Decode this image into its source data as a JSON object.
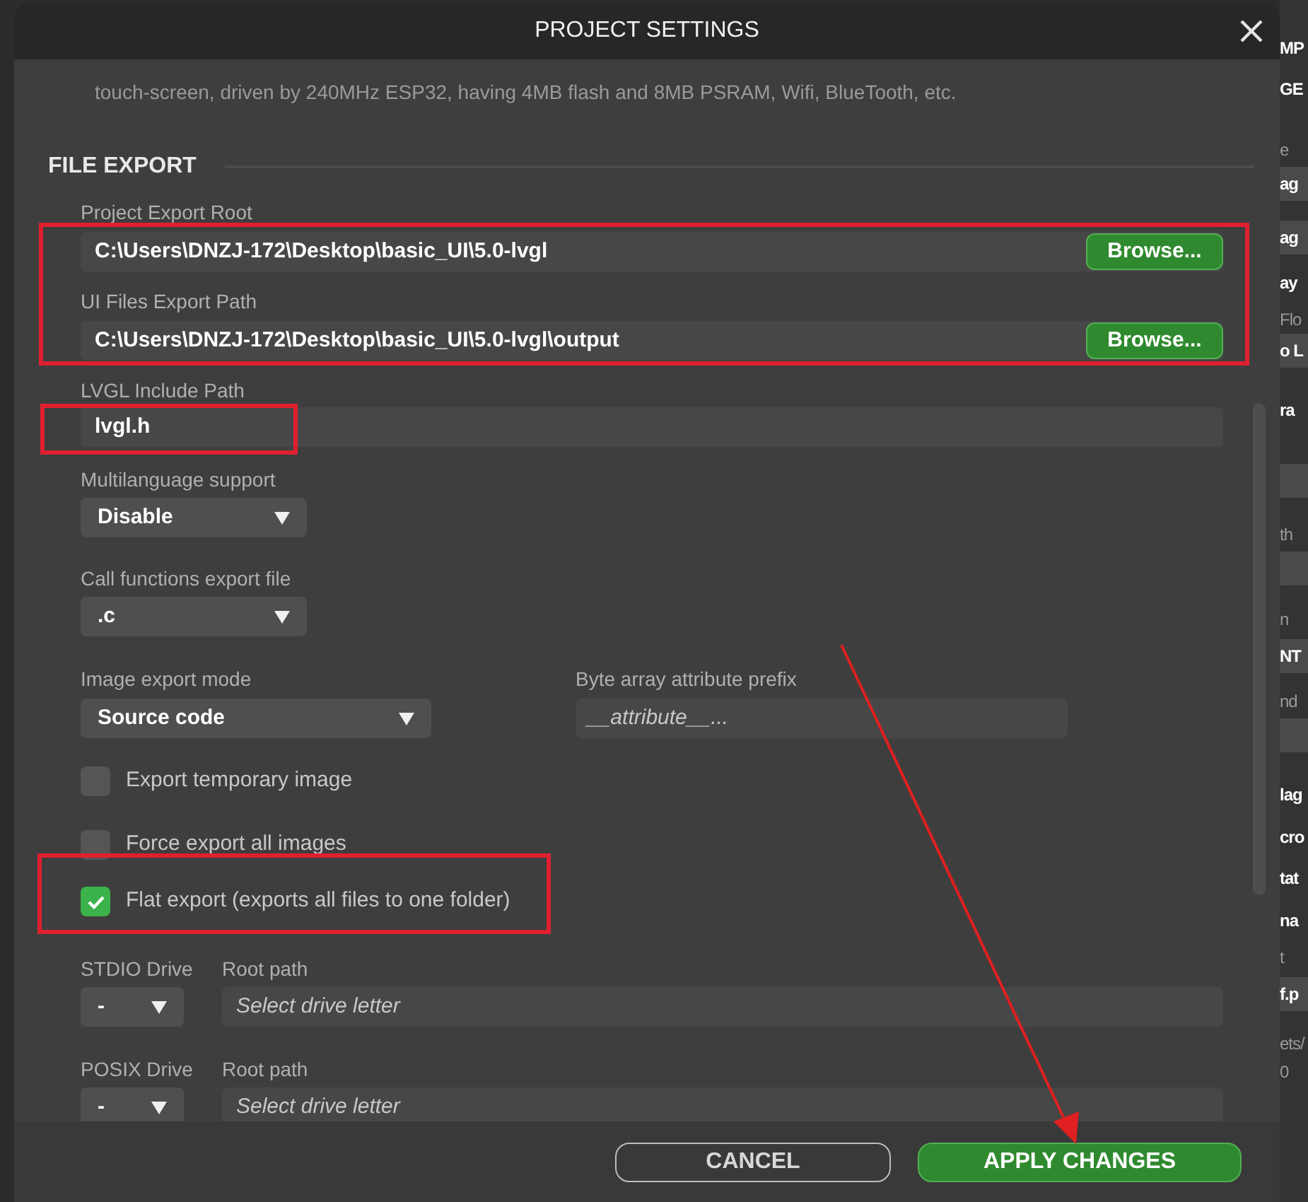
{
  "dialog": {
    "title": "PROJECT SETTINGS",
    "description": "touch-screen, driven by 240MHz ESP32, having 4MB flash and 8MB PSRAM, Wifi, BlueTooth, etc.",
    "section": "FILE EXPORT",
    "path_fields": [
      {
        "label": "Project Export Root",
        "value": "C:\\Users\\DNZJ-172\\Desktop\\basic_UI\\5.0-lvgl",
        "button": "Browse..."
      },
      {
        "label": "UI Files Export Path",
        "value": "C:\\Users\\DNZJ-172\\Desktop\\basic_UI\\5.0-lvgl\\output",
        "button": "Browse..."
      }
    ],
    "include_path": {
      "label": "LVGL Include Path",
      "value": "lvgl.h"
    },
    "dropdowns": [
      {
        "label": "Multilanguage support",
        "value": "Disable"
      },
      {
        "label": "Call functions export file",
        "value": ".c"
      }
    ],
    "image_export": {
      "label": "Image export mode",
      "value": "Source code"
    },
    "attribute_prefix": {
      "label": "Byte array attribute prefix",
      "placeholder": "__attribute__..."
    },
    "checkboxes": [
      {
        "label": "Export temporary image",
        "checked": false
      },
      {
        "label": "Force export all images",
        "checked": false
      },
      {
        "label": "Flat export (exports all files to one folder)",
        "checked": true
      }
    ],
    "drives": [
      {
        "label": "STDIO Drive",
        "value": "-",
        "root_label": "Root path",
        "placeholder": "Select drive letter"
      },
      {
        "label": "POSIX Drive",
        "value": "-",
        "root_label": "Root path",
        "placeholder": "Select drive letter"
      }
    ],
    "buttons": [
      {
        "label": "CANCEL",
        "kind": "secondary"
      },
      {
        "label": "APPLY CHANGES",
        "kind": "primary"
      }
    ]
  },
  "background_panel": {
    "fragments": [
      {
        "text": "MP",
        "kind": "bold"
      },
      {
        "text": "GE",
        "kind": "bold"
      },
      {
        "text": "e",
        "kind": "label"
      },
      {
        "text": "ag",
        "kind": "field"
      },
      {
        "text": "ag",
        "kind": "field"
      },
      {
        "text": "ay",
        "kind": "bold"
      },
      {
        "text": "Flo",
        "kind": "label"
      },
      {
        "text": "o L",
        "kind": "field"
      },
      {
        "text": "ra",
        "kind": "bold"
      },
      {
        "kind": "blank"
      },
      {
        "text": "th",
        "kind": "label"
      },
      {
        "kind": "blank"
      },
      {
        "text": "n",
        "kind": "label"
      },
      {
        "text": "NT",
        "kind": "field"
      },
      {
        "text": "nd",
        "kind": "label"
      },
      {
        "kind": "blank"
      },
      {
        "text": "lag",
        "kind": "bold"
      },
      {
        "text": "cro",
        "kind": "bold"
      },
      {
        "text": "tat",
        "kind": "bold"
      },
      {
        "text": "na",
        "kind": "bold"
      },
      {
        "text": "t",
        "kind": "label"
      },
      {
        "text": "f.p",
        "kind": "field"
      },
      {
        "text": "ets/",
        "kind": "label"
      },
      {
        "text": "0",
        "kind": "label"
      }
    ]
  }
}
